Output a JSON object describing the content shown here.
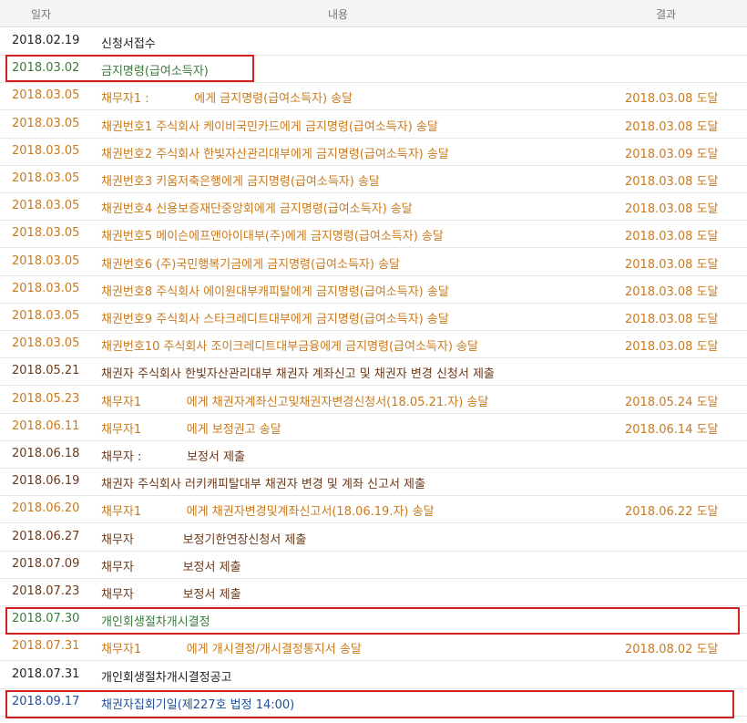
{
  "header": {
    "date": "일자",
    "content": "내용",
    "result": "결과"
  },
  "rows": [
    {
      "date": "2018.02.19",
      "content": "신청서접수",
      "result": "",
      "color": "black"
    },
    {
      "date": "2018.03.02",
      "content": "금지명령(급여소득자)",
      "result": "",
      "color": "green"
    },
    {
      "date": "2018.03.05",
      "content": "채무자1 :            에게 금지명령(급여소득자) 송달",
      "result": "2018.03.08 도달",
      "color": "orange"
    },
    {
      "date": "2018.03.05",
      "content": "채권번호1 주식회사 케이비국민카드에게 금지명령(급여소득자) 송달",
      "result": "2018.03.08 도달",
      "color": "orange"
    },
    {
      "date": "2018.03.05",
      "content": "채권번호2 주식회사 한빛자산관리대부에게 금지명령(급여소득자) 송달",
      "result": "2018.03.09 도달",
      "color": "orange"
    },
    {
      "date": "2018.03.05",
      "content": "채권번호3 키움저축은행에게 금지명령(급여소득자) 송달",
      "result": "2018.03.08 도달",
      "color": "orange"
    },
    {
      "date": "2018.03.05",
      "content": "채권번호4 신용보증재단중앙회에게 금지명령(급여소득자) 송달",
      "result": "2018.03.08 도달",
      "color": "orange"
    },
    {
      "date": "2018.03.05",
      "content": "채권번호5 메이슨에프앤아이대부(주)에게 금지명령(급여소득자) 송달",
      "result": "2018.03.08 도달",
      "color": "orange"
    },
    {
      "date": "2018.03.05",
      "content": "채권번호6 (주)국민행복기금에게 금지명령(급여소득자) 송달",
      "result": "2018.03.08 도달",
      "color": "orange"
    },
    {
      "date": "2018.03.05",
      "content": "채권번호8 주식회사 에이원대부캐피탈에게 금지명령(급여소득자) 송달",
      "result": "2018.03.08 도달",
      "color": "orange"
    },
    {
      "date": "2018.03.05",
      "content": "채권번호9 주식회사 스타크레디트대부에게 금지명령(급여소득자) 송달",
      "result": "2018.03.08 도달",
      "color": "orange"
    },
    {
      "date": "2018.03.05",
      "content": "채권번호10 주식회사 조이크레디트대부금융에게 금지명령(급여소득자) 송달",
      "result": "2018.03.08 도달",
      "color": "orange"
    },
    {
      "date": "2018.05.21",
      "content": "채권자 주식회사 한빛자산관리대부 채권자 계좌신고 및 채권자 변경 신청서 제출",
      "result": "",
      "color": "brown"
    },
    {
      "date": "2018.05.23",
      "content": "채무자1            에게 채권자계좌신고및채권자변경신청서(18.05.21.자) 송달",
      "result": "2018.05.24 도달",
      "color": "orange"
    },
    {
      "date": "2018.06.11",
      "content": "채무자1            에게 보정권고 송달",
      "result": "2018.06.14 도달",
      "color": "orange"
    },
    {
      "date": "2018.06.18",
      "content": "채무자 :            보정서 제출",
      "result": "",
      "color": "brown"
    },
    {
      "date": "2018.06.19",
      "content": "채권자 주식회사 러키캐피탈대부 채권자 변경 및 계좌 신고서 제출",
      "result": "",
      "color": "brown"
    },
    {
      "date": "2018.06.20",
      "content": "채무자1            에게 채권자변경및계좌신고서(18.06.19.자) 송달",
      "result": "2018.06.22 도달",
      "color": "orange"
    },
    {
      "date": "2018.06.27",
      "content": "채무자             보정기한연장신청서 제출",
      "result": "",
      "color": "brown"
    },
    {
      "date": "2018.07.09",
      "content": "채무자             보정서 제출",
      "result": "",
      "color": "brown"
    },
    {
      "date": "2018.07.23",
      "content": "채무자             보정서 제출",
      "result": "",
      "color": "brown"
    },
    {
      "date": "2018.07.30",
      "content": "개인회생절차개시결정",
      "result": "",
      "color": "green"
    },
    {
      "date": "2018.07.31",
      "content": "채무자1            에게 개시결정/개시결정통지서 송달",
      "result": "2018.08.02 도달",
      "color": "orange"
    },
    {
      "date": "2018.07.31",
      "content": "개인회생절차개시결정공고",
      "result": "",
      "color": "black"
    },
    {
      "date": "2018.09.17",
      "content": "채권자집회기일(제227호 법정 14:00)",
      "result": "",
      "color": "blue"
    }
  ]
}
